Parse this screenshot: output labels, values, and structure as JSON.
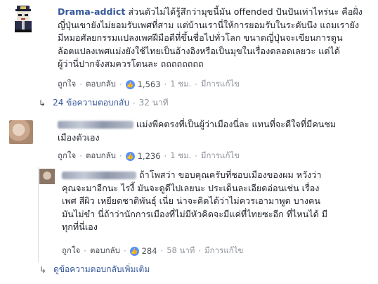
{
  "comment1": {
    "author": "Drama-addict",
    "lines": [
      "ส่วนตัวไม่ได้รู้สึกว่ามุขนี้มัน offended ปันปันเท่าไหร่นะ คือฝั่ง",
      "ญี่ปุ่นเขายังไม่ยอมรับเพศที่สาม แต่บ้านเรานี่ให้การยอมรับในระดับนึง แถมเรายัง",
      "มีหมอศัลยกรรมแปลงเพศฝีมือดีที่ขึ้นชื่อไปทั่วโลก ขนาดญี่ปุ่นจะเขียนการตูน",
      "ล้อตแปลงเพศแม่งยังใช้ไทยเป็นอ้างอิงหรือเป็นมุขในเรื่องตลอดเลยวะ แต่ได้",
      "ผู้ว่านี่ปากจังสมควรโดนละ ถถถถถถถถ"
    ],
    "actions": {
      "like": "ถูกใจ",
      "reply": "ตอบกลับ",
      "likes": "1,563",
      "time": "1 ชม.",
      "edited": "มีการแก้ไข"
    },
    "replies_link": "24 ข้อความตอบกลับ",
    "replies_time": "32 นาที"
  },
  "comment2": {
    "lines": [
      "แม่งพีคตรงที่เป็นผู้ว่าเมืองนี่ละ แทนที่จะดีใจที่มีคนชม",
      "เมืองตัวเอง"
    ],
    "actions": {
      "like": "ถูกใจ",
      "reply": "ตอบกลับ",
      "likes": "1,236",
      "time": "1 ชม.",
      "edited": "มีการแก้ไข"
    }
  },
  "comment3": {
    "lines": [
      "ถ้าโพสว่า ขอบคุณครับที่ชอบเมืองของผม หวังว่า",
      "คุณจะมาอีกนะ ไรงี้ มันจะดูดีไปเลยนะ ประเด็นละเอียดอ่อนเช่น เรื่อง",
      "เพศ สีผิว เหยียดชาติพันธุ์ เนี่ย น่าจะคิดได้ว่าไม่ควรเอามาพูด บางคน",
      "มันไม่ขำ นี่ถ้าว่านักการเมืองที่ไม่มีหัวคิดจะมีแค่ที่ไทยซะอีก ที่ไหนได้ มี",
      "ทุกที่นี่เอง"
    ],
    "actions": {
      "like": "ถูกใจ",
      "reply": "ตอบกลับ",
      "likes": "284",
      "time": "58 นาที",
      "edited": "มีการแก้ไข"
    }
  },
  "more_replies": "ดูข้อความตอบกลับเพิ่มเติม",
  "colors": {
    "link": "#365899",
    "text": "#1d2129",
    "meta": "#90949c",
    "like": "#5890ff"
  }
}
